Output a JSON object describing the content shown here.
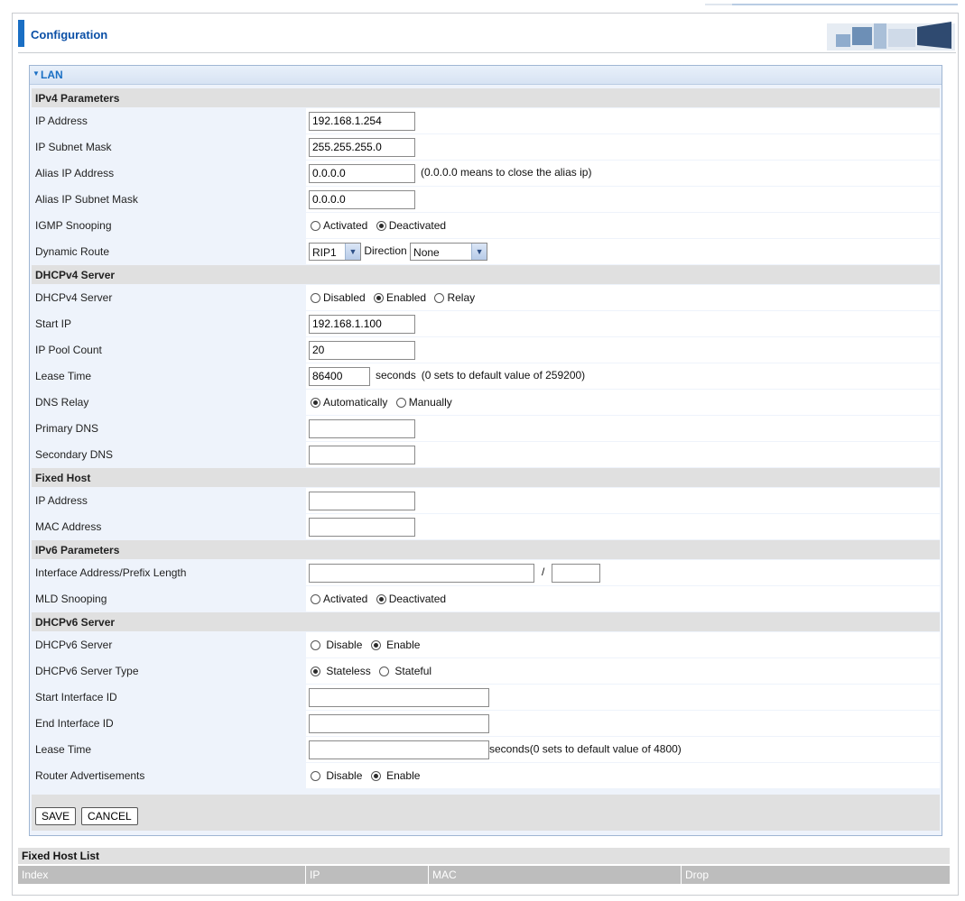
{
  "header": {
    "title": "Configuration"
  },
  "lan": {
    "label": "LAN"
  },
  "ipv4": {
    "section": "IPv4 Parameters",
    "ip_address": {
      "label": "IP Address",
      "value": "192.168.1.254"
    },
    "subnet_mask": {
      "label": "IP Subnet Mask",
      "value": "255.255.255.0"
    },
    "alias_ip": {
      "label": "Alias IP Address",
      "value": "0.0.0.0",
      "note": "(0.0.0.0 means to close the alias ip)"
    },
    "alias_mask": {
      "label": "Alias IP Subnet Mask",
      "value": "0.0.0.0"
    },
    "igmp": {
      "label": "IGMP Snooping",
      "opt_activated": "Activated",
      "opt_deactivated": "Deactivated",
      "selected": "Deactivated"
    },
    "dynamic_route": {
      "label": "Dynamic Route",
      "value": "RIP1",
      "direction_label": "Direction",
      "direction_value": "None"
    }
  },
  "dhcpv4": {
    "section": "DHCPv4 Server",
    "server": {
      "label": "DHCPv4 Server",
      "opt_disabled": "Disabled",
      "opt_enabled": "Enabled",
      "opt_relay": "Relay",
      "selected": "Enabled"
    },
    "start_ip": {
      "label": "Start IP",
      "value": "192.168.1.100"
    },
    "pool_count": {
      "label": "IP Pool Count",
      "value": "20"
    },
    "lease_time": {
      "label": "Lease Time",
      "value": "86400",
      "unit": "seconds",
      "note": "(0 sets to default value of 259200)"
    },
    "dns_relay": {
      "label": "DNS Relay",
      "opt_auto": "Automatically",
      "opt_manual": "Manually",
      "selected": "Automatically"
    },
    "primary_dns": {
      "label": "Primary DNS",
      "value": ""
    },
    "secondary_dns": {
      "label": "Secondary DNS",
      "value": ""
    }
  },
  "fixed_host": {
    "section": "Fixed Host",
    "ip_address": {
      "label": "IP Address",
      "value": ""
    },
    "mac_address": {
      "label": "MAC Address",
      "value": ""
    }
  },
  "ipv6": {
    "section": "IPv6 Parameters",
    "interface_address": {
      "label": "Interface Address/Prefix Length",
      "value": "",
      "separator": "/",
      "prefix": ""
    },
    "mld": {
      "label": "MLD Snooping",
      "opt_activated": "Activated",
      "opt_deactivated": "Deactivated",
      "selected": "Deactivated"
    }
  },
  "dhcpv6": {
    "section": "DHCPv6 Server",
    "server": {
      "label": "DHCPv6 Server",
      "opt_disable": "Disable",
      "opt_enable": "Enable",
      "selected": "Enable"
    },
    "server_type": {
      "label": "DHCPv6 Server Type",
      "opt_stateless": "Stateless",
      "opt_stateful": "Stateful",
      "selected": "Stateless"
    },
    "start_id": {
      "label": "Start Interface ID",
      "value": ""
    },
    "end_id": {
      "label": "End Interface ID",
      "value": ""
    },
    "lease_time": {
      "label": "Lease Time",
      "value": "",
      "note": "seconds(0 sets to default value of 4800)"
    },
    "router_adv": {
      "label": "Router Advertisements",
      "opt_disable": "Disable",
      "opt_enable": "Enable",
      "selected": "Enable"
    }
  },
  "buttons": {
    "save": "SAVE",
    "cancel": "CANCEL"
  },
  "fixed_host_list": {
    "title": "Fixed Host List",
    "columns": [
      "Index",
      "IP",
      "MAC",
      "Drop"
    ]
  }
}
